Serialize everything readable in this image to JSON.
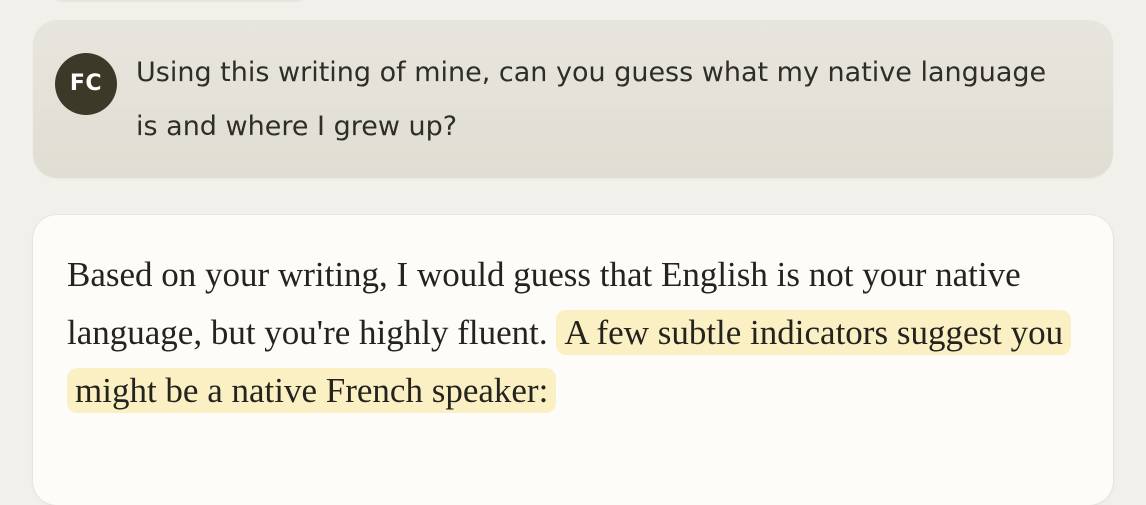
{
  "user_message": {
    "avatar_initials": "FC",
    "text": "Using this writing of mine, can you guess what my native language is and where I grew up?"
  },
  "assistant_message": {
    "text_plain": "Based on your writing, I would guess that English is not your native language, but you're highly fluent.",
    "text_highlighted": "A few subtle indicators suggest you might be a native French speaker:",
    "highlight_color": "#fbf0c4"
  },
  "colors": {
    "page_background": "#f1f0ea",
    "user_bubble": "#e4e2d9",
    "avatar": "#3d3929",
    "assistant_card": "#fdfcf9"
  }
}
